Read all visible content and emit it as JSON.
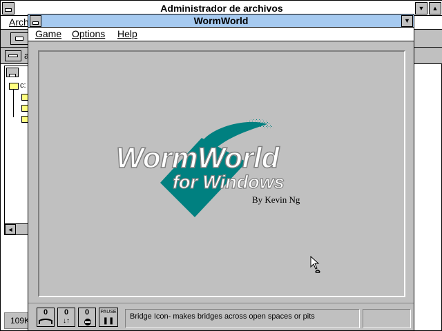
{
  "background_window": {
    "title": "Administrador de archivos",
    "menu_first": "Arch",
    "drive_label": "a",
    "tree_root": "c:",
    "status_text": "109K"
  },
  "wormworld": {
    "title": "WormWorld",
    "menu": {
      "game": "Game",
      "options": "Options",
      "help": "Help"
    },
    "logo": {
      "line1": "WormWorld",
      "line2": "for Windows",
      "byline": "By Kevin Ng"
    },
    "tools": [
      {
        "count": "0",
        "icon": "bridge-icon"
      },
      {
        "count": "0",
        "icon": "arrows-icon"
      },
      {
        "count": "0",
        "icon": "stop-icon"
      }
    ],
    "pause_label": "PAUSE",
    "status_message": "Bridge Icon- makes bridges across open spaces or pits"
  },
  "colors": {
    "titlebar_active": "#a6caf0",
    "logo_teal": "#008080",
    "window_gray": "#c0c0c0"
  }
}
